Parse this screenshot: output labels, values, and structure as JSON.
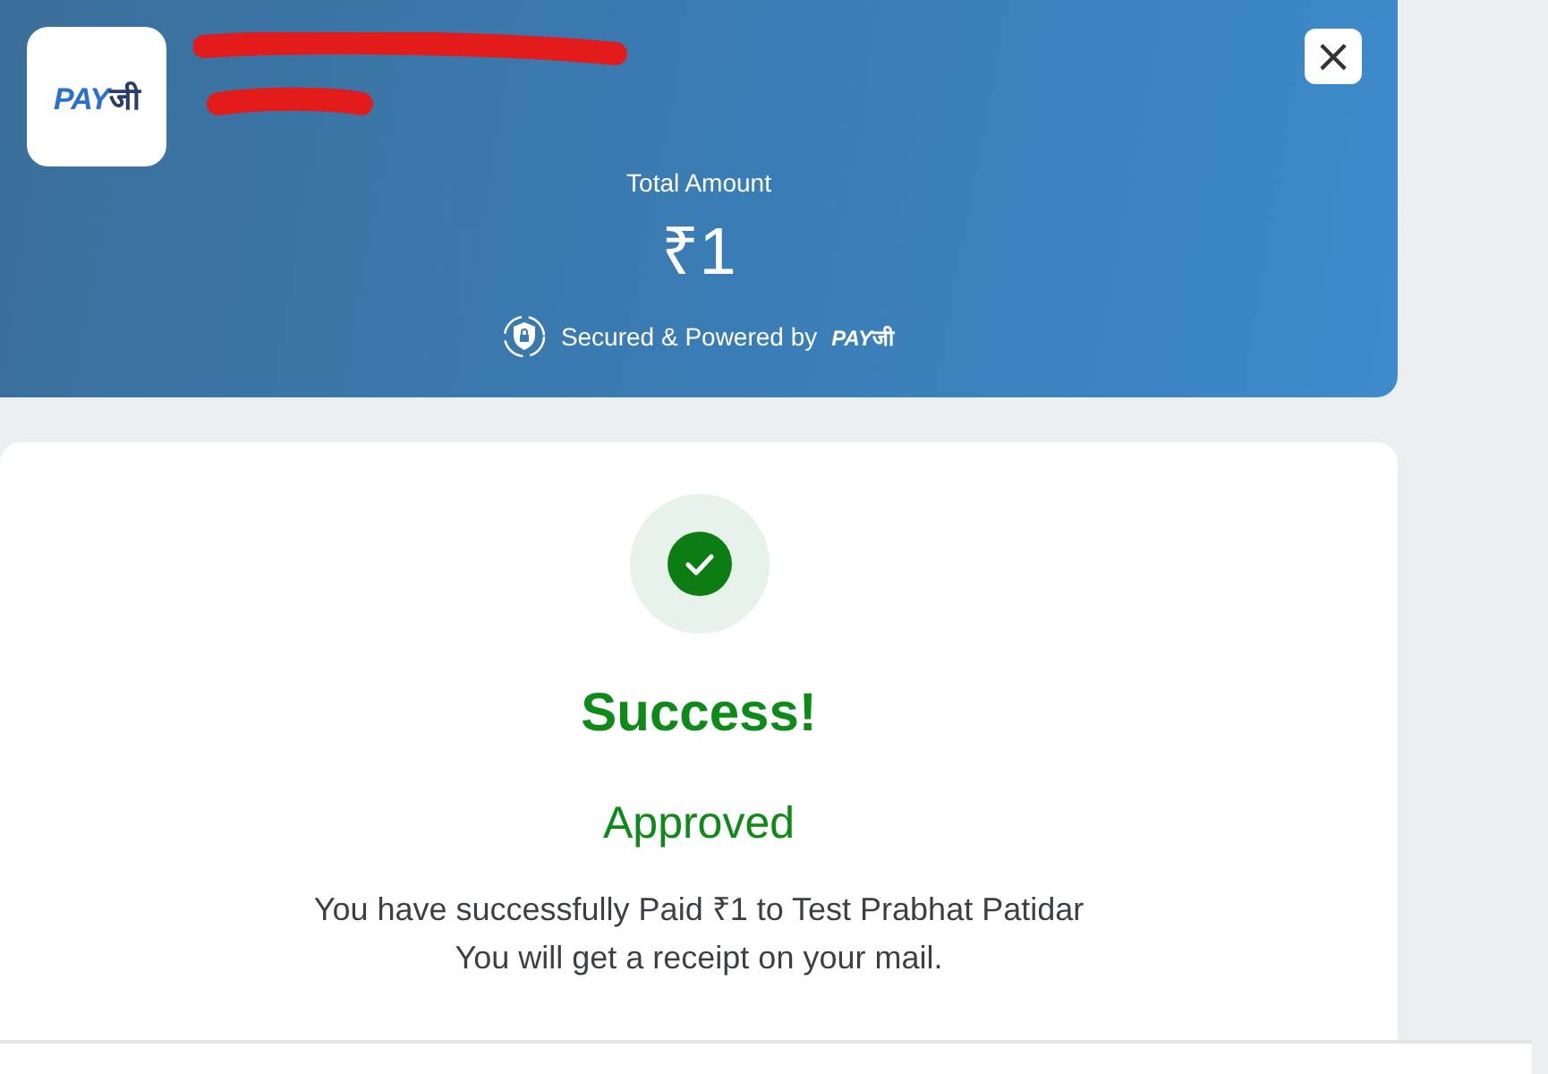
{
  "header": {
    "logo": {
      "part_1": "PAY",
      "part_2": "जी"
    },
    "close": "×",
    "total_label": "Total Amount",
    "amount": "₹1",
    "secured_text": "Secured & Powered by",
    "powered_logo": {
      "part_1": "PAY",
      "part_2": "जी"
    }
  },
  "result": {
    "title": "Success!",
    "status": "Approved",
    "lines": [
      "You have successfully Paid ₹1 to Test Prabhat Patidar",
      "You will get a receipt on your mail."
    ]
  }
}
